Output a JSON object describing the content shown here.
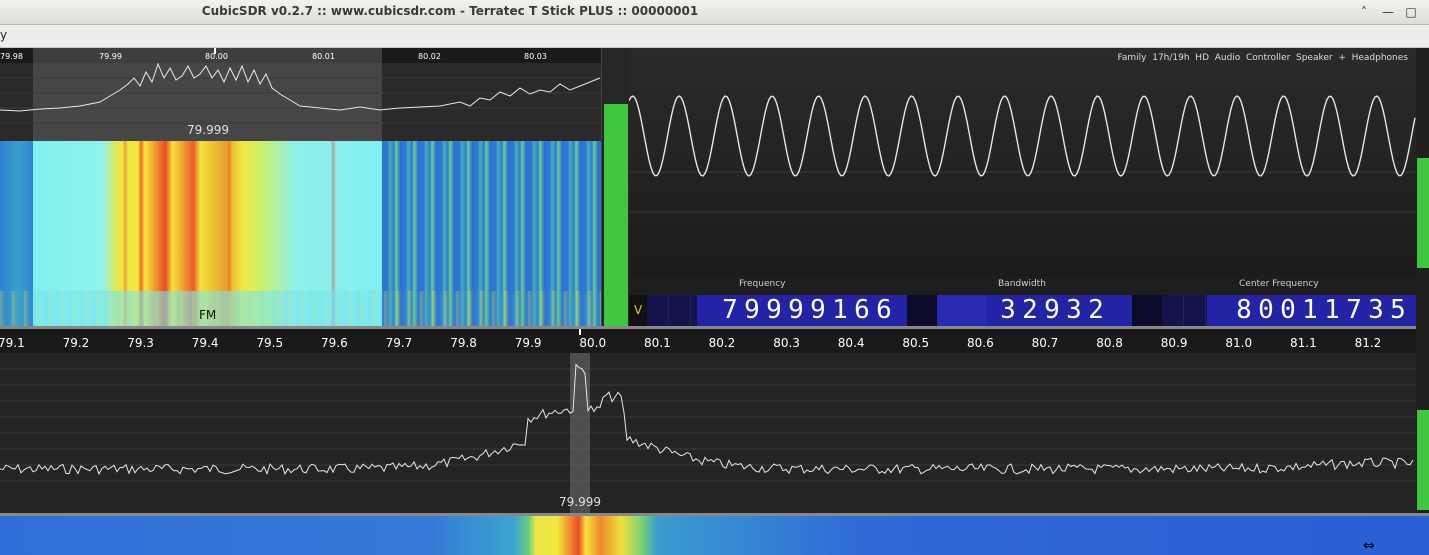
{
  "window": {
    "title": "CubicSDR v0.2.7 :: www.cubicsdr.com - Terratec T Stick PLUS :: 00000001",
    "minimize_icon": "minimize-icon",
    "maximize_icon": "maximize-icon",
    "close_icon": "close-icon",
    "minimize_glyph": "—",
    "maximize_glyph": "□",
    "close_glyph": "˄"
  },
  "menubar": {
    "partial_label": "y"
  },
  "demod_spectrum": {
    "ticks": [
      "79.98",
      "79.99",
      "80.00",
      "80.01",
      "80.02",
      "80.03"
    ],
    "selected_freq": "79.999"
  },
  "demod_waterfall": {
    "mode_label": "FM"
  },
  "scope": {
    "audio_device": "Family  17h/19h  HD  Audio  Controller  Speaker  +  Headphones"
  },
  "readouts": {
    "squelch_label": "V",
    "frequency_label": "Frequency",
    "frequency_value": "79999166",
    "bandwidth_label": "Bandwidth",
    "bandwidth_value": "32932",
    "center_label": "Center  Frequency",
    "center_value": "80011735"
  },
  "main_spectrum": {
    "ticks": [
      "79.1",
      "79.2",
      "79.3",
      "79.4",
      "79.5",
      "79.6",
      "79.7",
      "79.8",
      "79.9",
      "80.0",
      "80.1",
      "80.2",
      "80.3",
      "80.4",
      "80.5",
      "80.6",
      "80.7",
      "80.8",
      "80.9",
      "81.0",
      "81.1",
      "81.2"
    ],
    "selected_freq": "79.999"
  },
  "colors": {
    "level_green": "#3fc83f",
    "digit_bg": "#2222a8",
    "digit_panel": "#1a1a6a",
    "waterfall_hot": "#f2e62a",
    "waterfall_cool": "#2a7ad8"
  }
}
